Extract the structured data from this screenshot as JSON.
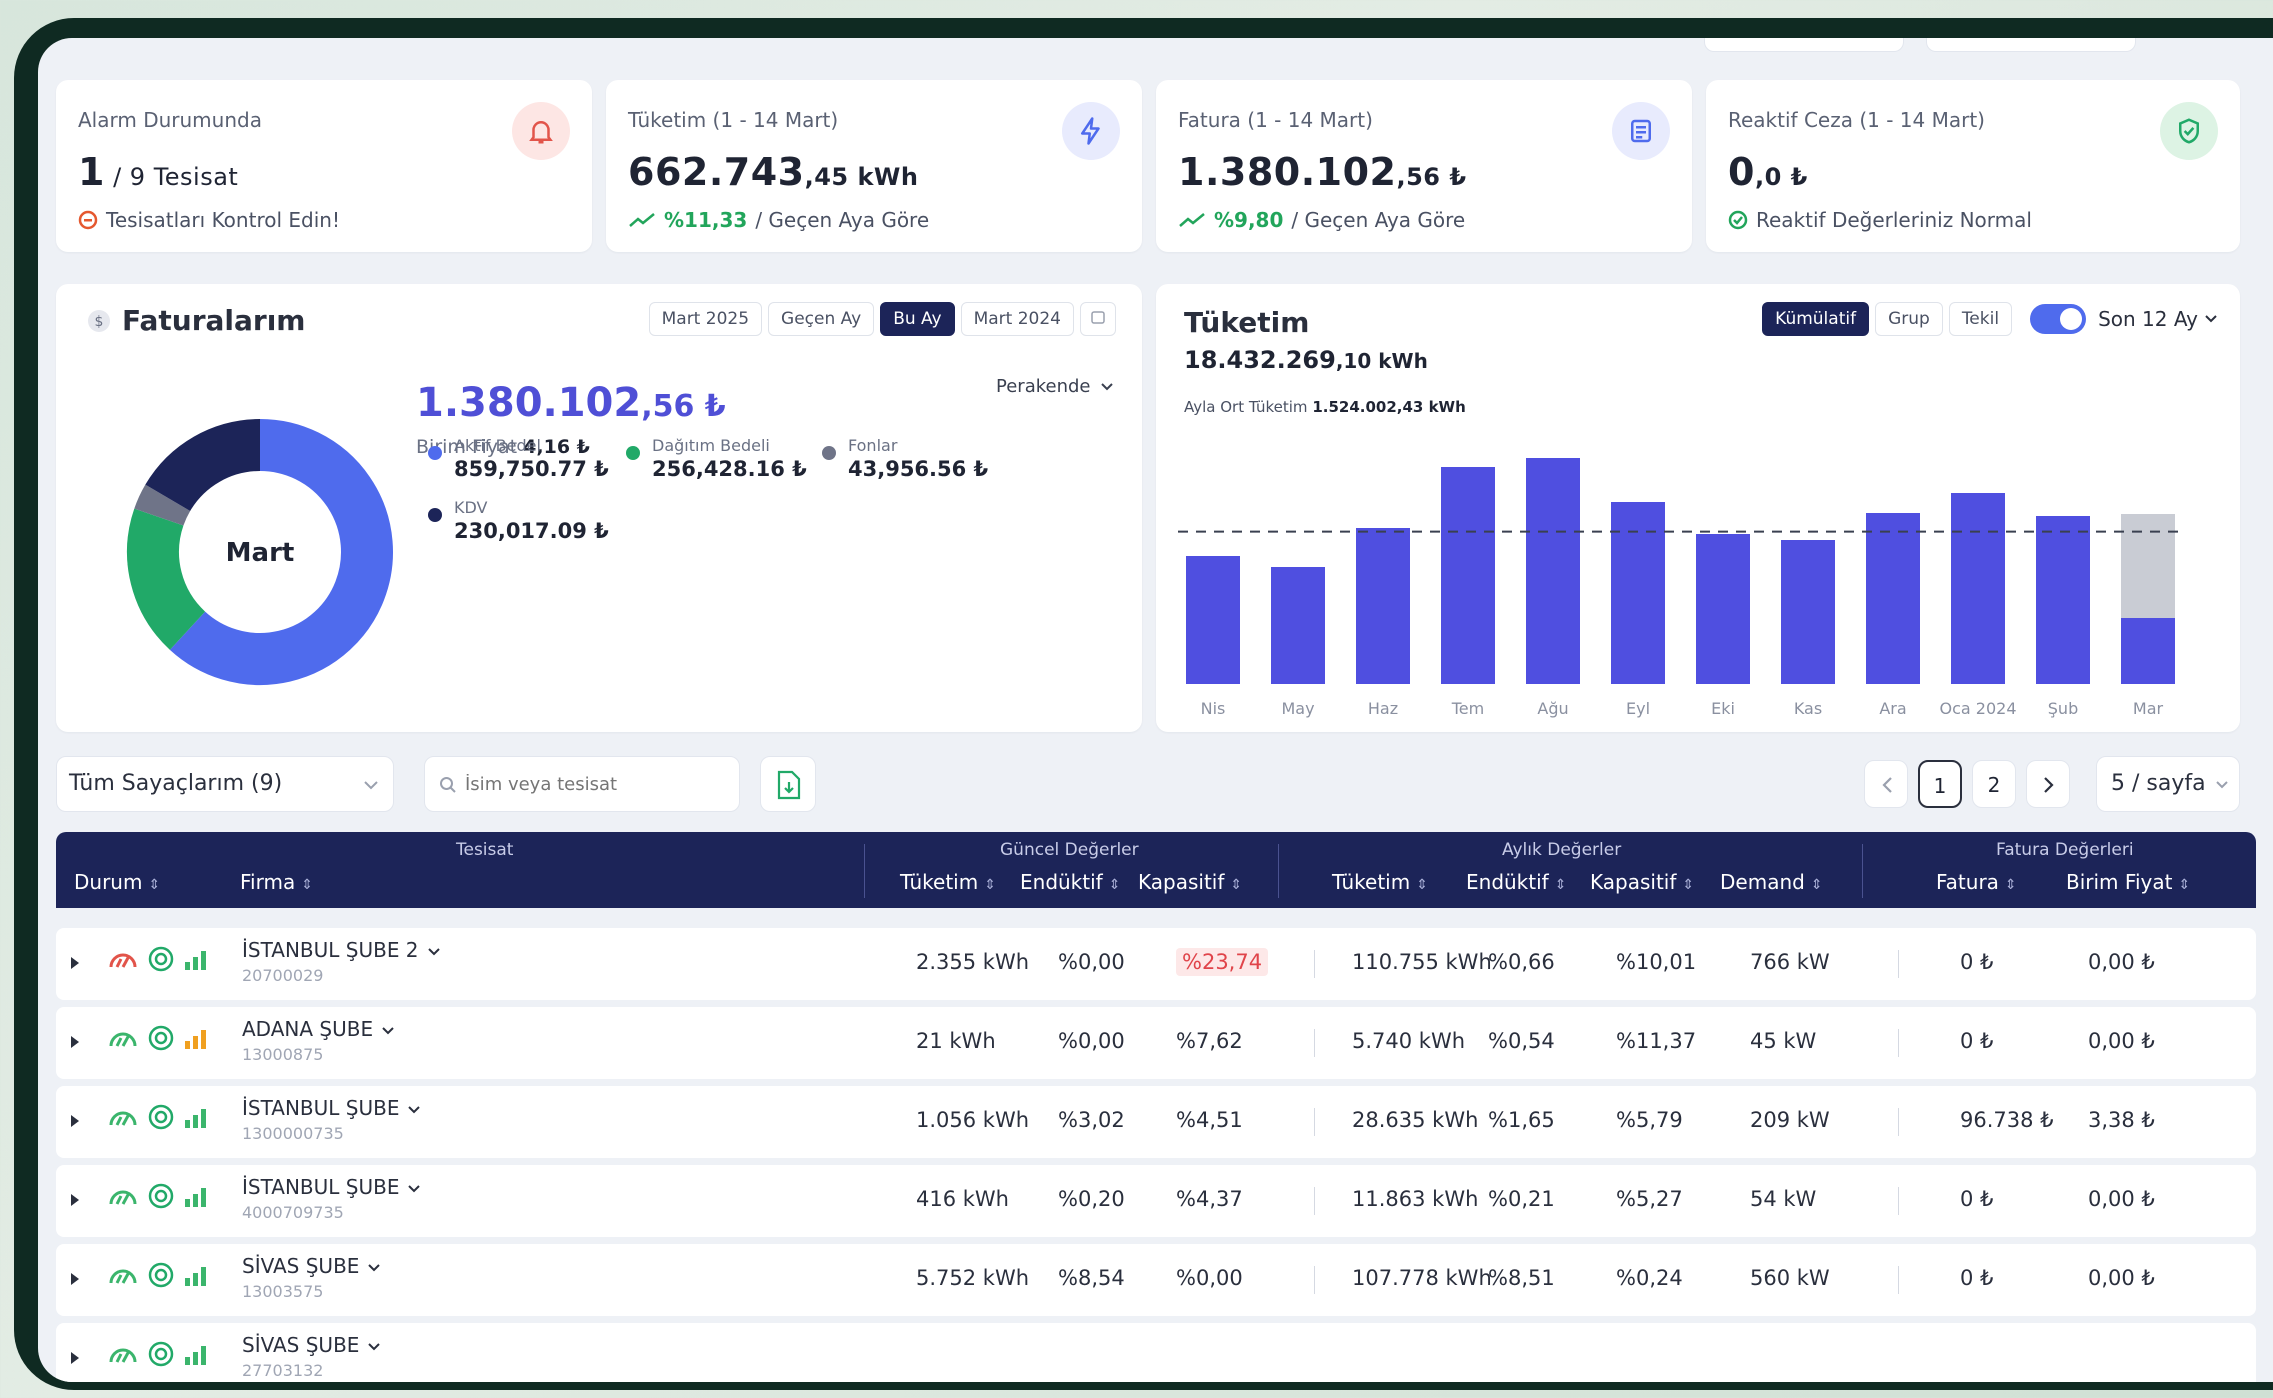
{
  "kpis": {
    "alarm": {
      "label": "Alarm Durumunda",
      "value_main": "1",
      "value_rest": " / 9 Tesisat",
      "sub": "Tesisatları Kontrol Edin!"
    },
    "consumption": {
      "label": "Tüketim (1 - 14 Mart)",
      "value_main": "662.743",
      "value_dec": ",45",
      "unit": " kWh",
      "change": "%11,33",
      "change_text": " / Geçen Aya Göre"
    },
    "invoice": {
      "label": "Fatura (1 - 14 Mart)",
      "value_main": "1.380.102",
      "value_dec": ",56",
      "unit": " ₺",
      "change": "%9,80",
      "change_text": " / Geçen Aya Göre"
    },
    "reactive": {
      "label": "Reaktif Ceza (1 - 14 Mart)",
      "value_main": "0",
      "value_dec": ",0",
      "unit": " ₺",
      "sub": "Reaktif Değerleriniz Normal"
    }
  },
  "invoices": {
    "title": "Faturalarım",
    "tabs": [
      "Mart 2025",
      "Geçen Ay",
      "Bu Ay",
      "Mart 2024"
    ],
    "active_tab": "Bu Ay",
    "total_main": "1.380.102",
    "total_dec": ",56 ₺",
    "unit_price_label": "Birim Fiyat",
    "unit_price": "4,16 ₺",
    "tariff": "Perakende",
    "donut_label": "Mart",
    "legend": [
      {
        "name": "Aktif Bedel",
        "value": "859,750.77 ₺",
        "color": "#4f6bed"
      },
      {
        "name": "Dağıtım Bedeli",
        "value": "256,428.16 ₺",
        "color": "#21a968"
      },
      {
        "name": "Fonlar",
        "value": "43,956.56 ₺",
        "color": "#6f7488"
      },
      {
        "name": "KDV",
        "value": "230,017.09 ₺",
        "color": "#1c2458"
      }
    ],
    "chart_data": {
      "type": "pie",
      "categories": [
        "Aktif Bedel",
        "Dağıtım Bedeli",
        "Fonlar",
        "KDV"
      ],
      "values": [
        859750.77,
        256428.16,
        43956.56,
        230017.09
      ]
    }
  },
  "consumption_chart": {
    "title": "Tüketim",
    "total_main": "18.432.269",
    "total_dec": ",10 kWh",
    "tabs": [
      "Kümülatif",
      "Grup",
      "Tekil"
    ],
    "active_tab": "Kümülatif",
    "range": "Son 12 Ay",
    "avg_label": "Ayla Ort Tüketim",
    "avg_value": "1.524.002,43 kWh",
    "chart_data": {
      "type": "bar",
      "categories": [
        "Nis",
        "May",
        "Haz",
        "Tem",
        "Ağu",
        "Eyl",
        "Eki",
        "Kas",
        "Ara",
        "Oca 2024",
        "Şub",
        "Mar"
      ],
      "values": [
        1280000,
        1170000,
        1560000,
        2170000,
        2260000,
        1820000,
        1500000,
        1440000,
        1710000,
        1910000,
        1680000,
        660000
      ],
      "mar_projected": 1700000,
      "average": 1524002.43,
      "ylim": [
        0,
        2400000
      ]
    }
  },
  "controls": {
    "meter_select": "Tüm Sayaçlarım (9)",
    "search_placeholder": "İsim veya tesisat",
    "pages": [
      "1",
      "2"
    ],
    "current_page": "1",
    "per_page": "5 / sayfa"
  },
  "table": {
    "groups": {
      "tesisat": "Tesisat",
      "current": "Güncel Değerler",
      "monthly": "Aylık Değerler",
      "invoice": "Fatura Değerleri"
    },
    "headers": {
      "durum": "Durum",
      "firma": "Firma",
      "c_tuketim": "Tüketim",
      "c_enduktif": "Endüktif",
      "c_kapasitif": "Kapasitif",
      "m_tuketim": "Tüketim",
      "m_enduktif": "Endüktif",
      "m_kapasitif": "Kapasitif",
      "m_demand": "Demand",
      "fatura": "Fatura",
      "birim": "Birim Fiyat"
    },
    "rows": [
      {
        "name": "İSTANBUL ŞUBE 2",
        "code": "20700029",
        "c_tuketim": "2.355 kWh",
        "c_enduktif": "%0,00",
        "c_kapasitif": "%23,74",
        "alert": true,
        "m_tuketim": "110.755 kWh",
        "m_enduktif": "%0,66",
        "m_kapasitif": "%10,01",
        "m_demand": "766 kW",
        "fatura": "0 ₺",
        "birim": "0,00 ₺",
        "gauge": "#e2544a",
        "bars": "#3bb56c"
      },
      {
        "name": "ADANA ŞUBE",
        "code": "13000875",
        "c_tuketim": "21 kWh",
        "c_enduktif": "%0,00",
        "c_kapasitif": "%7,62",
        "alert": false,
        "m_tuketim": "5.740 kWh",
        "m_enduktif": "%0,54",
        "m_kapasitif": "%11,37",
        "m_demand": "45 kW",
        "fatura": "0 ₺",
        "birim": "0,00 ₺",
        "gauge": "#3bb56c",
        "bars": "#f0a020"
      },
      {
        "name": "İSTANBUL ŞUBE",
        "code": "1300000735",
        "c_tuketim": "1.056 kWh",
        "c_enduktif": "%3,02",
        "c_kapasitif": "%4,51",
        "alert": false,
        "m_tuketim": "28.635 kWh",
        "m_enduktif": "%1,65",
        "m_kapasitif": "%5,79",
        "m_demand": "209 kW",
        "fatura": "96.738 ₺",
        "birim": "3,38 ₺",
        "gauge": "#3bb56c",
        "bars": "#3bb56c"
      },
      {
        "name": "İSTANBUL ŞUBE",
        "code": "4000709735",
        "c_tuketim": "416 kWh",
        "c_enduktif": "%0,20",
        "c_kapasitif": "%4,37",
        "alert": false,
        "m_tuketim": "11.863 kWh",
        "m_enduktif": "%0,21",
        "m_kapasitif": "%5,27",
        "m_demand": "54 kW",
        "fatura": "0 ₺",
        "birim": "0,00 ₺",
        "gauge": "#3bb56c",
        "bars": "#3bb56c"
      },
      {
        "name": "SİVAS ŞUBE",
        "code": "13003575",
        "c_tuketim": "5.752 kWh",
        "c_enduktif": "%8,54",
        "c_kapasitif": "%0,00",
        "alert": false,
        "m_tuketim": "107.778 kWh",
        "m_enduktif": "%8,51",
        "m_kapasitif": "%0,24",
        "m_demand": "560 kW",
        "fatura": "0 ₺",
        "birim": "0,00 ₺",
        "gauge": "#3bb56c",
        "bars": "#3bb56c"
      },
      {
        "name": "SİVAS ŞUBE",
        "code": "27703132",
        "c_tuketim": "",
        "c_enduktif": "",
        "c_kapasitif": "",
        "alert": false,
        "m_tuketim": "",
        "m_enduktif": "",
        "m_kapasitif": "",
        "m_demand": "",
        "fatura": "",
        "birim": "",
        "gauge": "#3bb56c",
        "bars": "#3bb56c"
      }
    ]
  },
  "colors": {
    "primary": "#4f6bed",
    "navy": "#1c2458",
    "green": "#21a968",
    "red": "#e0444a"
  }
}
